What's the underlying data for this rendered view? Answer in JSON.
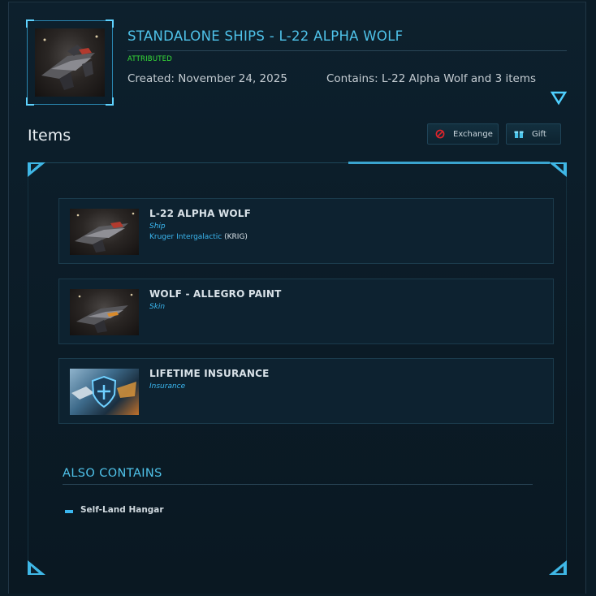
{
  "header": {
    "title": "STANDALONE SHIPS - L-22 ALPHA WOLF",
    "status": "ATTRIBUTED",
    "created": "Created: November 24, 2025",
    "contains": "Contains: L-22 Alpha Wolf and 3 items"
  },
  "items_section": {
    "heading": "Items",
    "exchange_label": "Exchange",
    "gift_label": "Gift"
  },
  "items": [
    {
      "name": "L-22 ALPHA WOLF",
      "type": "Ship",
      "manufacturer": "Kruger Intergalactic",
      "manufacturer_code": "(KRIG)"
    },
    {
      "name": "WOLF - ALLEGRO PAINT",
      "type": "Skin"
    },
    {
      "name": "LIFETIME INSURANCE",
      "type": "Insurance"
    }
  ],
  "also_contains": {
    "heading": "ALSO CONTAINS",
    "items": [
      "Self-Land Hangar"
    ]
  },
  "colors": {
    "accent": "#4fc3ea",
    "status_green": "#38e038",
    "link_blue": "#3bb7f0",
    "background": "#0b1c27"
  },
  "icons": {
    "expand": "chevron-down-icon",
    "exchange": "exchange-icon",
    "gift": "gift-icon"
  }
}
